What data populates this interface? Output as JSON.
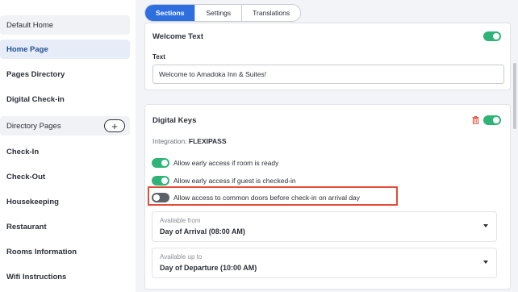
{
  "sidebar": {
    "items": [
      {
        "label": "Default Home"
      },
      {
        "label": "Home Page"
      },
      {
        "label": "Pages Directory"
      },
      {
        "label": "Digital Check-in"
      },
      {
        "label": "Directory Pages",
        "action": "+"
      },
      {
        "label": "Check-In"
      },
      {
        "label": "Check-Out"
      },
      {
        "label": "Housekeeping"
      },
      {
        "label": "Restaurant"
      },
      {
        "label": "Rooms Information"
      },
      {
        "label": "Wifi Instructions"
      }
    ]
  },
  "tabs": [
    {
      "label": "Sections",
      "active": true
    },
    {
      "label": "Settings",
      "active": false
    },
    {
      "label": "Translations",
      "active": false
    }
  ],
  "welcome_card": {
    "title": "Welcome Text",
    "enabled": true,
    "field_label": "Text",
    "field_value": "Welcome to Amadoka Inn & Suites!"
  },
  "keys_card": {
    "title": "Digital Keys",
    "enabled": true,
    "integration_label": "Integration:",
    "integration_value": "FLEXIPASS",
    "options": [
      {
        "label": "Allow early access if room is ready",
        "enabled": true
      },
      {
        "label": "Allow early access if guest is checked-in",
        "enabled": true
      },
      {
        "label": "Allow access to common doors before check-in on arrival day",
        "enabled": false
      }
    ],
    "available_from": {
      "label": "Available from",
      "value": "Day of Arrival (08:00 AM)"
    },
    "available_to": {
      "label": "Available up to",
      "value": "Day of Departure (10:00 AM)"
    }
  },
  "colors": {
    "accent": "#2e6fe0",
    "toggle_on": "#2fb478",
    "toggle_off": "#5c6068",
    "highlight": "#e24b36",
    "trash": "#e24b36"
  },
  "icons": {
    "add": "plus-icon",
    "delete": "trash-icon",
    "dropdown": "chevron-down-icon"
  }
}
